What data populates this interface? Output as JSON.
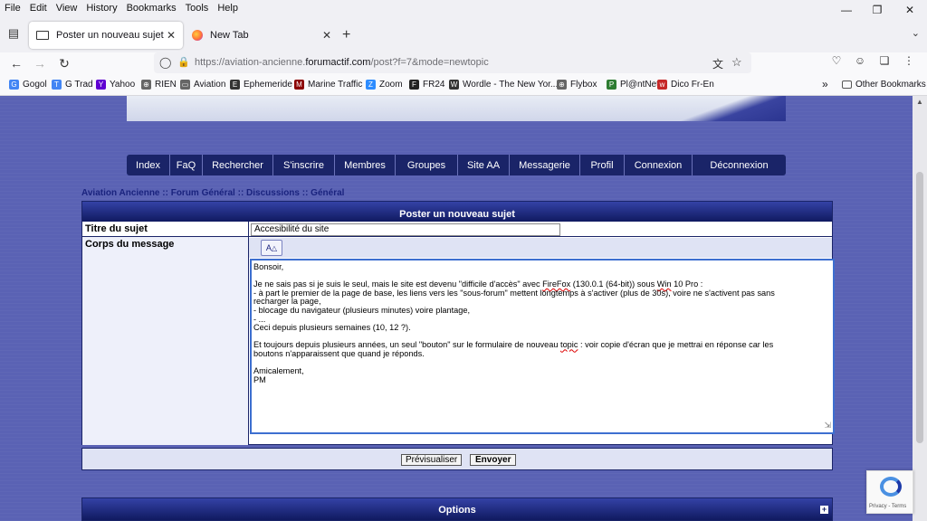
{
  "menu": [
    "File",
    "Edit",
    "View",
    "History",
    "Bookmarks",
    "Tools",
    "Help"
  ],
  "tabs": [
    {
      "title": "Poster un nouveau sujet",
      "active": true
    },
    {
      "title": "New Tab",
      "active": false
    }
  ],
  "url": {
    "prefix": "https://aviation-ancienne.",
    "host": "forumactif.com",
    "suffix": "/post?f=7&mode=newtopic"
  },
  "bookmarks": [
    {
      "label": "Gogol",
      "icon": "G",
      "color": "#4285f4"
    },
    {
      "label": "G Trad",
      "icon": "T",
      "color": "#4285f4"
    },
    {
      "label": "Yahoo",
      "icon": "Y",
      "color": "#6001d2"
    },
    {
      "label": "RIEN",
      "icon": "⊕",
      "color": "#666666"
    },
    {
      "label": "Aviation",
      "icon": "▭",
      "color": "#666666"
    },
    {
      "label": "Ephemeride",
      "icon": "E",
      "color": "#333333"
    },
    {
      "label": "Marine Traffic",
      "icon": "M",
      "color": "#8b0000"
    },
    {
      "label": "Zoom",
      "icon": "Z",
      "color": "#2d8cff"
    },
    {
      "label": "FR24",
      "icon": "F",
      "color": "#222222"
    },
    {
      "label": "Wordle - The New Yor...",
      "icon": "W",
      "color": "#333333"
    },
    {
      "label": "Flybox",
      "icon": "⊕",
      "color": "#666666"
    },
    {
      "label": "Pl@ntNet",
      "icon": "P",
      "color": "#2e7d32"
    },
    {
      "label": "Dico Fr-En",
      "icon": "w",
      "color": "#c62828"
    }
  ],
  "other_bookmarks": "Other Bookmarks",
  "overflow_glyph": "»",
  "nav": [
    "Index",
    "FaQ",
    "Rechercher",
    "S'inscrire",
    "Membres",
    "Groupes",
    "Site AA",
    "Messagerie",
    "Profil",
    "Connexion",
    "Déconnexion"
  ],
  "breadcrumb": "Aviation Ancienne :: Forum Général :: Discussions :: Général",
  "form": {
    "title": "Poster un nouveau sujet",
    "subject_label": "Titre du sujet",
    "subject_value": "Accesibilité du site",
    "body_label": "Corps du message",
    "format_button": "A",
    "body_lines": [
      "Bonsoir,",
      "",
      "Je ne sais pas si je suis le seul, mais le site est devenu \"difficile d'accès\" avec FireFox (130.0.1 (64-bit)) sous Win 10 Pro :",
      "- à part le premier de la page de base, les liens vers les \"sous-forum\" mettent longtemps à s'activer (plus de 30s), voire ne s'activent pas sans",
      "recharger la page,",
      "- blocage du navigateur (plusieurs minutes) voire plantage,",
      "- ...",
      "Ceci depuis plusieurs semaines (10, 12 ?).",
      "",
      "Et toujours depuis plusieurs années, un seul \"bouton\" sur le formulaire de nouveau topic : voir copie d'écran que je mettrai en réponse car les",
      "boutons n'apparaissent que quand je réponds.",
      "",
      "Amicalement,",
      "PM"
    ],
    "preview_button": "Prévisualiser",
    "send_button": "Envoyer"
  },
  "options_title": "Options",
  "options_toggle": "+",
  "recaptcha_text": "Privacy - Terms"
}
